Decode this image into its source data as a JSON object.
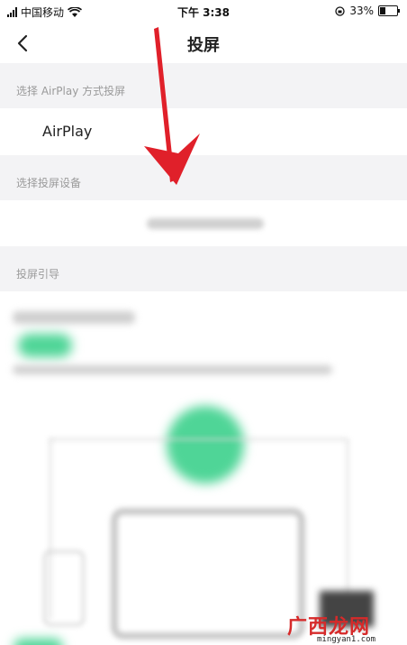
{
  "status_bar": {
    "carrier": "中国移动",
    "time": "下午 3:38",
    "battery_percent": "33%",
    "battery_level": 0.33
  },
  "nav": {
    "title": "投屏"
  },
  "sections": {
    "airplay_header": "选择 AirPlay 方式投屏",
    "airplay_item": "AirPlay",
    "device_header": "选择投屏设备",
    "guide_header": "投屏引导"
  },
  "watermark": {
    "brand": "广西龙网",
    "url": "mingyan1.com"
  },
  "colors": {
    "arrow_red": "#e0202a",
    "accent_green": "#4fd597"
  }
}
